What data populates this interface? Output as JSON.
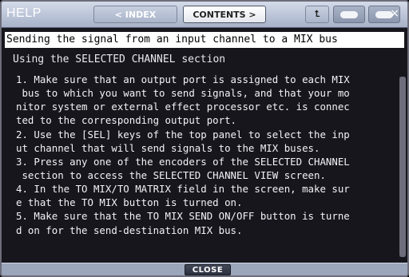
{
  "window": {
    "title": "HELP",
    "nav": {
      "index_label": "< INDEX",
      "contents_label": "CONTENTS >",
      "up_label": "⮤",
      "close_glyph": "×"
    }
  },
  "topic": {
    "title": "Sending the signal from an input channel to a MIX bus",
    "subtitle": "Using the SELECTED CHANNEL section",
    "lines": [
      "1. Make sure that an output port is assigned to each MIX",
      " bus to which you want to send signals, and that your mo",
      "nitor system or external effect processor etc. is connec",
      "ted to the corresponding output port.",
      "2. Use the [SEL] keys of the top panel to select the inp",
      "ut channel that will send signals to the MIX buses.",
      "3. Press any one of the encoders of the SELECTED CHANNEL",
      " section to access the SELECTED CHANNEL VIEW screen.",
      "4. In the TO MIX/TO MATRIX field in the screen, make sur",
      "e that the TO MIX button is turned on.",
      "5. Make sure that the TO MIX SEND ON/OFF button is turne",
      "d on for the send-destination MIX bus."
    ]
  },
  "footer": {
    "close_label": "CLOSE"
  },
  "colors": {
    "titlebar": "#b9c2d6",
    "background": "#16161c",
    "highlight": "#ffffff",
    "text": "#f3f3f7"
  },
  "icons": {
    "up": "return-up-icon",
    "prev": "prev-page-icon",
    "next": "next-page-icon",
    "close": "close-icon"
  }
}
